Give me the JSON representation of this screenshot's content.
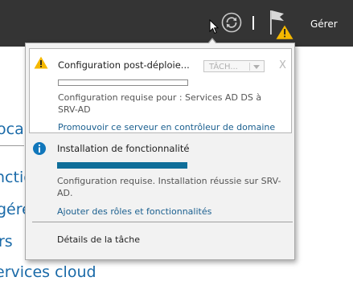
{
  "header": {
    "manage_label": "Gérer",
    "refresh_icon": "refresh-icon",
    "flag_icon": "notification-flag-icon",
    "warning_badge_icon": "warning-icon"
  },
  "background": {
    "lines": [
      "ocal",
      "nctio",
      "gére",
      "rs",
      "ervices cloud"
    ]
  },
  "notifications": {
    "items": [
      {
        "icon": "warning-icon",
        "title": "Configuration post-déploie...",
        "task_select": "TÂCH...",
        "close_label": "X",
        "progress": 0,
        "message": "Configuration requise pour : Services AD DS à SRV-AD",
        "link": "Promouvoir ce serveur en contrôleur de domaine"
      },
      {
        "icon": "info-icon",
        "title": "Installation de fonctionnalité",
        "progress": 1,
        "message": "Configuration requise. Installation réussie sur SRV-AD.",
        "link": "Ajouter des rôles et fonctionnalités"
      }
    ],
    "task_details_label": "Détails de la tâche"
  },
  "colors": {
    "topbar": "#343434",
    "link": "#1a5f8f",
    "progress_fill": "#0f6e99",
    "warning": "#f5b800",
    "info": "#1177bb"
  }
}
